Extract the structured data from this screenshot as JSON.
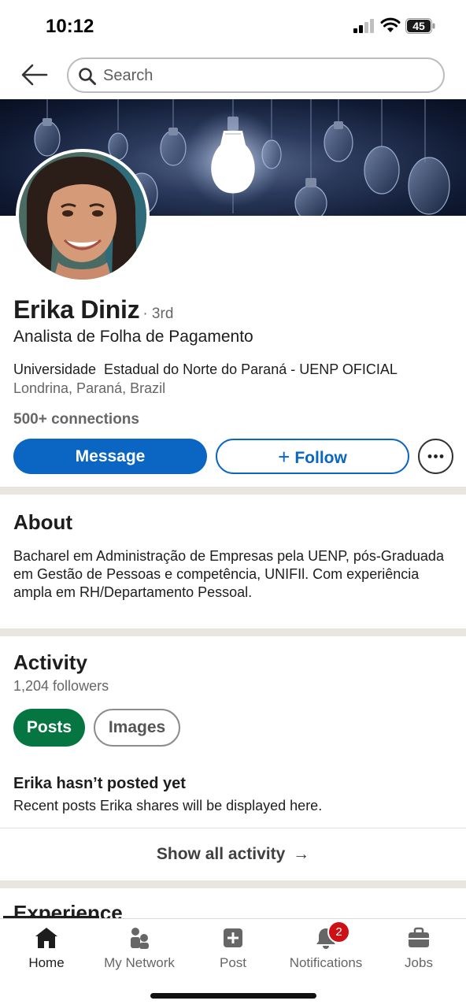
{
  "status_bar": {
    "time": "10:12",
    "battery": "45"
  },
  "header": {
    "search_placeholder": "Search"
  },
  "profile": {
    "name": "Erika Diniz",
    "degree": "· 3rd",
    "headline": "Analista de Folha de Pagamento",
    "education": "Universidade  Estadual do Norte do Paraná - UENP OFICIAL",
    "location": "Londrina, Paraná, Brazil",
    "connections": "500+ connections",
    "actions": {
      "message": "Message",
      "follow": "Follow",
      "follow_icon": "+"
    }
  },
  "about": {
    "title": "About",
    "text": "Bacharel em Administração de Empresas pela UENP, pós-Graduada em Gestão de Pessoas e competência, UNIFIl. Com experiência ampla em RH/Departamento Pessoal."
  },
  "activity": {
    "title": "Activity",
    "followers": "1,204 followers",
    "tabs": [
      "Posts",
      "Images"
    ],
    "selected_tab": "Posts",
    "empty_title": "Erika hasn’t posted yet",
    "empty_subtitle": "Recent posts Erika shares will be displayed here.",
    "show_all": "Show all activity",
    "show_all_arrow": "→"
  },
  "experience": {
    "title": "Experience"
  },
  "bottom_nav": {
    "items": [
      {
        "label": "Home",
        "icon": "home-icon",
        "active": true
      },
      {
        "label": "My Network",
        "icon": "network-icon"
      },
      {
        "label": "Post",
        "icon": "post-icon"
      },
      {
        "label": "Notifications",
        "icon": "bell-icon",
        "badge": "2"
      },
      {
        "label": "Jobs",
        "icon": "briefcase-icon"
      }
    ]
  },
  "colors": {
    "primary_blue": "#0a66c2",
    "posts_green": "#057642",
    "badge_red": "#cc1016",
    "section_divider": "#e9e5df"
  }
}
